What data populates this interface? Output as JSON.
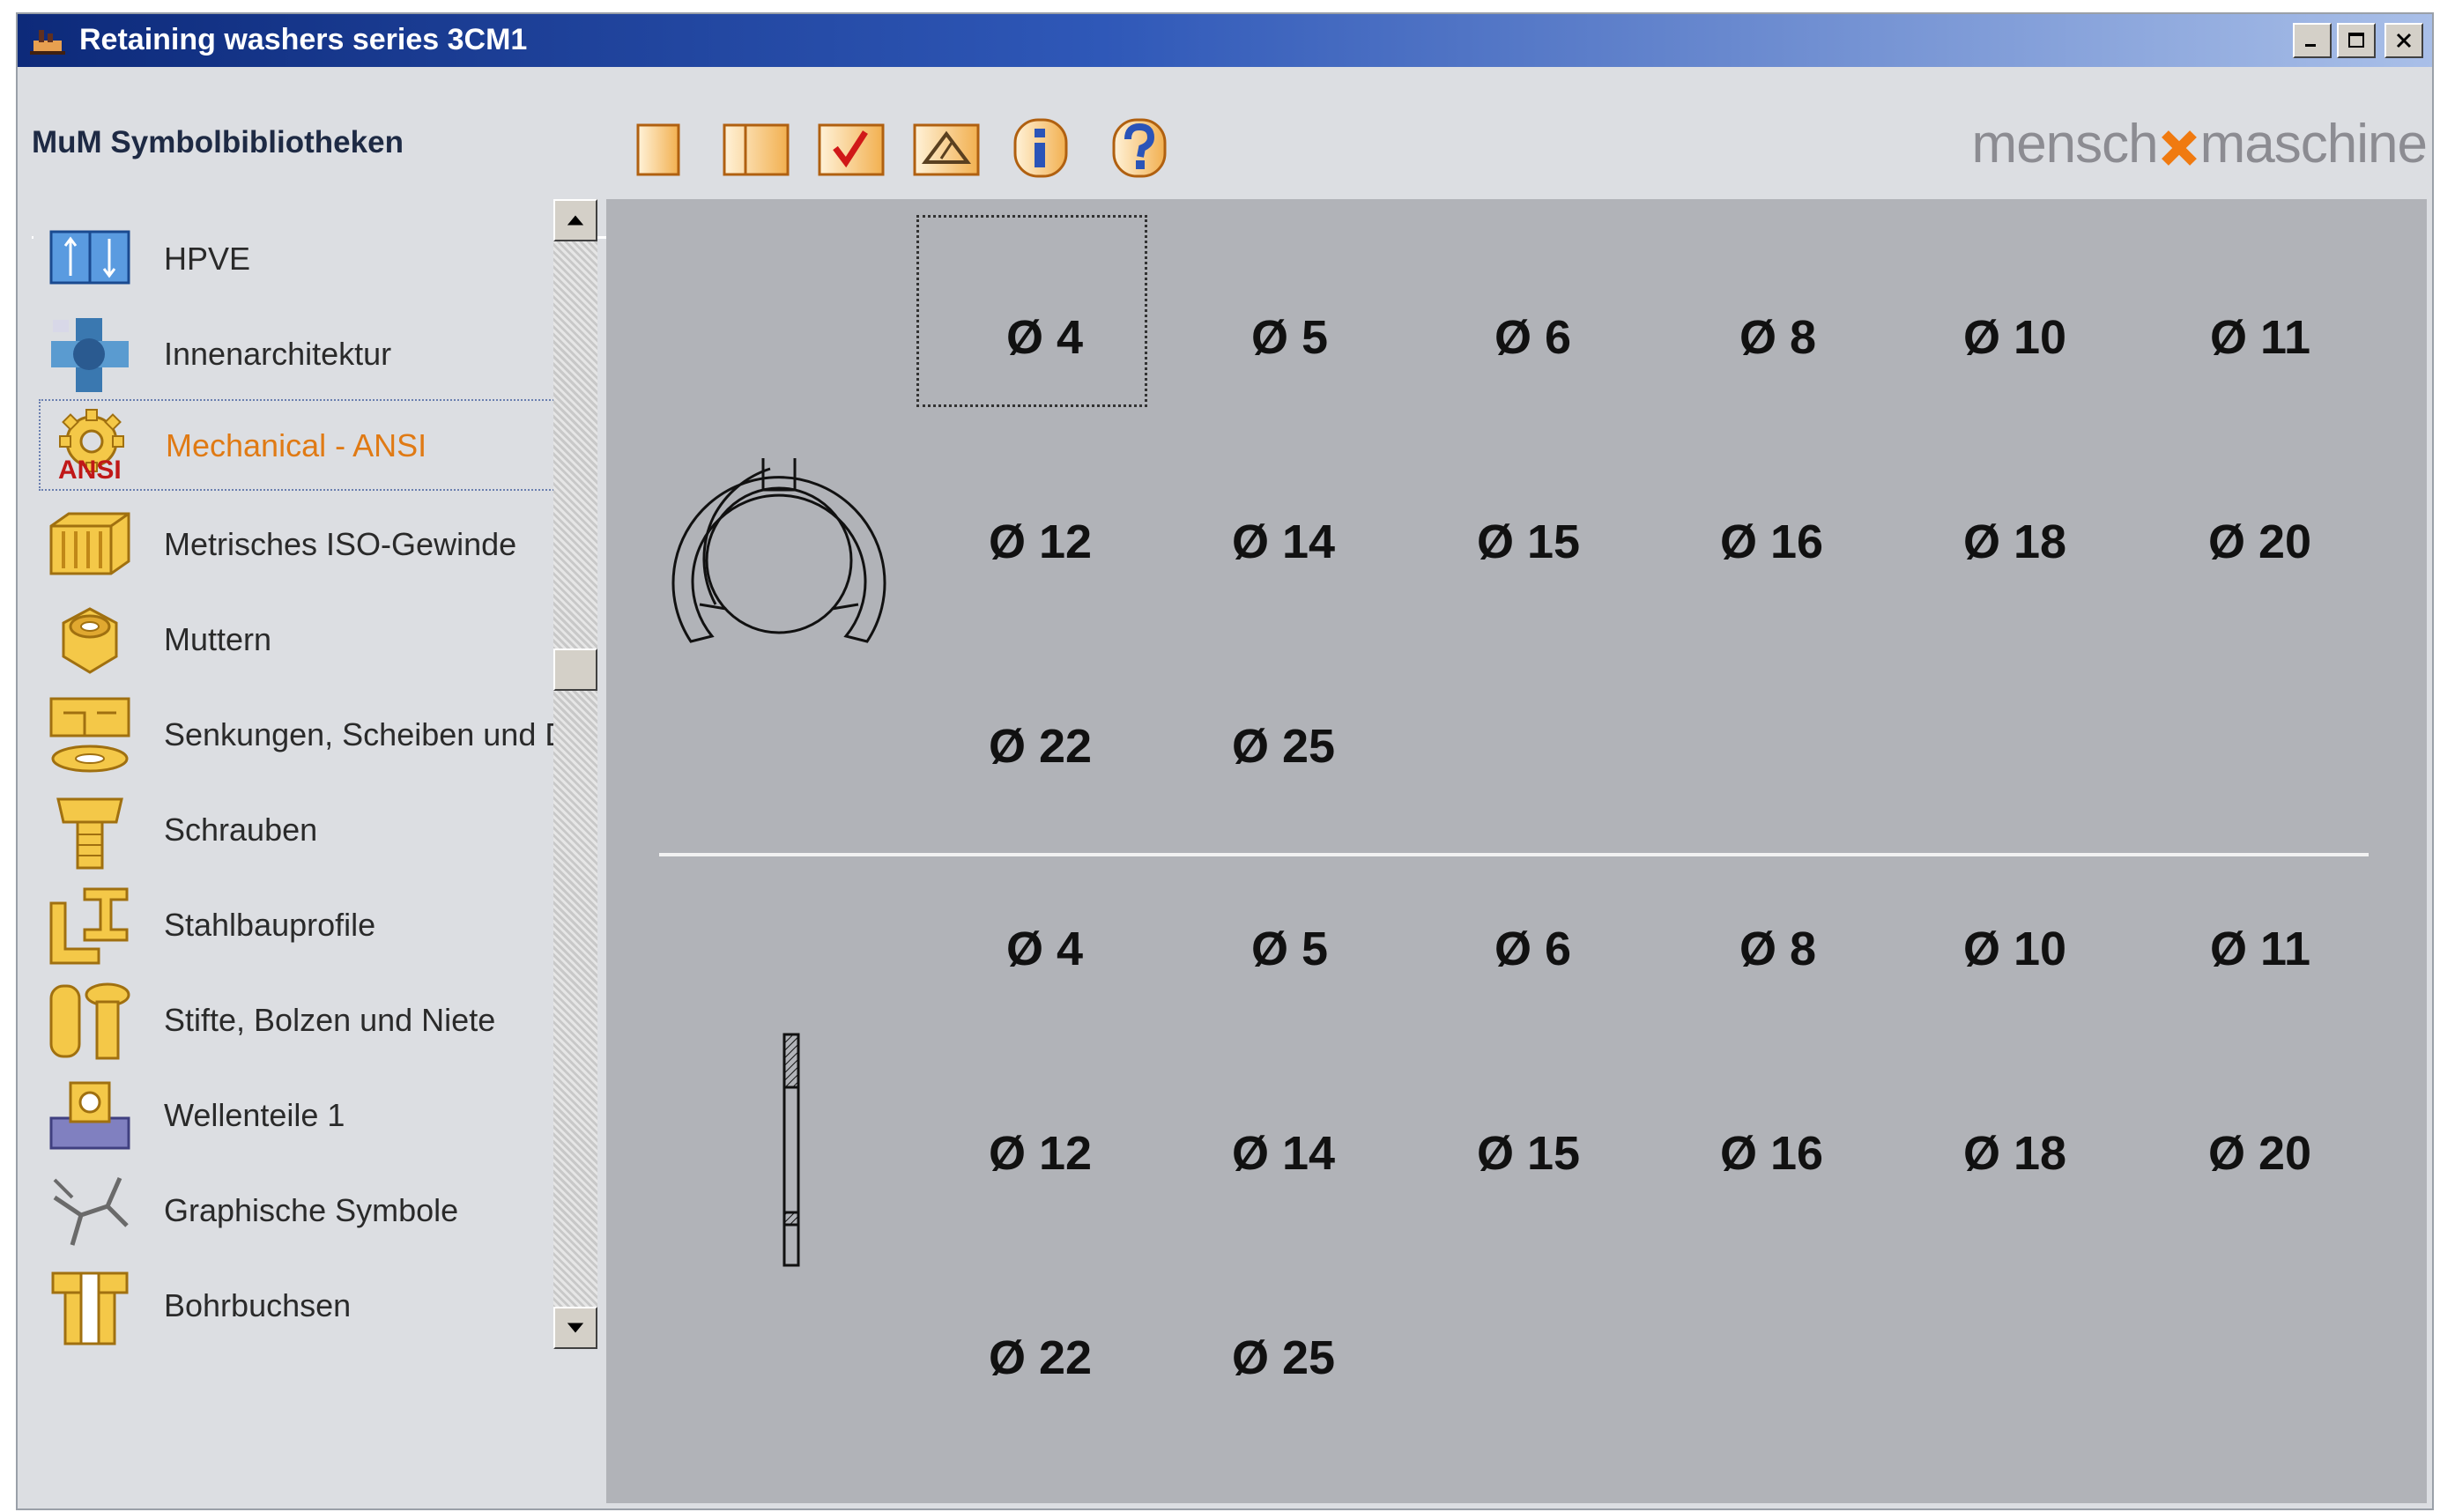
{
  "window": {
    "title": "Retaining washers series 3CM1"
  },
  "toolbar": {
    "label": "MuM Symbolbibliotheken",
    "buttons": [
      {
        "icon": "blank-page-icon"
      },
      {
        "icon": "split-page-icon"
      },
      {
        "icon": "checkmark-page-icon"
      },
      {
        "icon": "insert-shape-icon"
      },
      {
        "icon": "info-icon"
      },
      {
        "icon": "help-icon"
      }
    ],
    "logo_left": "mensch",
    "logo_right": "maschine"
  },
  "sidebar": {
    "items": [
      {
        "label": "HPVE",
        "icon": "hpve-icon"
      },
      {
        "label": "Innenarchitektur",
        "icon": "interior-icon"
      },
      {
        "label": "Mechanical - ANSI",
        "icon": "gear-ansi-icon",
        "badge": "ANSI",
        "selected": true
      },
      {
        "label": "Metrisches ISO-Gewinde",
        "icon": "thread-icon"
      },
      {
        "label": "Muttern",
        "icon": "nut-icon"
      },
      {
        "label": "Senkungen, Scheiben und Du",
        "icon": "washer-icon"
      },
      {
        "label": "Schrauben",
        "icon": "screw-icon"
      },
      {
        "label": "Stahlbauprofile",
        "icon": "steel-profile-icon"
      },
      {
        "label": "Stifte, Bolzen und Niete",
        "icon": "pin-icon"
      },
      {
        "label": "Wellenteile 1",
        "icon": "shaft-part-icon"
      },
      {
        "label": "Graphische Symbole",
        "icon": "graphic-symbol-icon"
      },
      {
        "label": "Bohrbuchsen",
        "icon": "bushing-icon"
      }
    ]
  },
  "content": {
    "top_view": {
      "sizes": [
        "Ø 4",
        "Ø 5",
        "Ø 6",
        "Ø 8",
        "Ø 10",
        "Ø 11",
        "Ø 12",
        "Ø 14",
        "Ø 15",
        "Ø 16",
        "Ø 18",
        "Ø 20",
        "Ø 22",
        "Ø 25"
      ]
    },
    "side_view": {
      "sizes": [
        "Ø 4",
        "Ø 5",
        "Ø 6",
        "Ø 8",
        "Ø 10",
        "Ø 11",
        "Ø 12",
        "Ø 14",
        "Ø 15",
        "Ø 16",
        "Ø 18",
        "Ø 20",
        "Ø 22",
        "Ø 25"
      ]
    }
  },
  "colors": {
    "selected_text": "#e07a14",
    "content_bg": "#b1b3b8",
    "logo_accent": "#f07a10"
  }
}
